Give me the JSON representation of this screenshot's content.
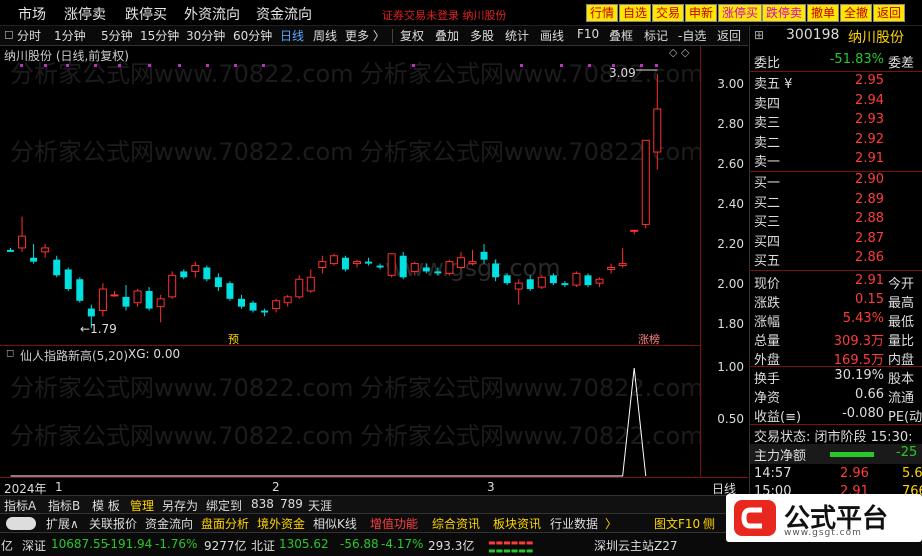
{
  "menu": {
    "items": [
      "市场",
      "涨停卖",
      "跌停买",
      "外资流向",
      "资金流向"
    ],
    "notice": "证券交易未登录 纳川股份",
    "buttons": [
      "行情",
      "自选",
      "交易",
      "申新",
      "涨停买",
      "跌停卖",
      "撤单",
      "全撤",
      "返回"
    ]
  },
  "period": {
    "items": [
      "分时",
      "1分钟",
      "5分钟",
      "15分钟",
      "30分钟",
      "60分钟",
      "日线",
      "周线",
      "更多 〉"
    ],
    "active": "日线",
    "tools": [
      "复权",
      "叠加",
      "多股",
      "统计",
      "画线",
      "F10",
      "叠框",
      "标记",
      "-自选",
      "返回"
    ]
  },
  "chart": {
    "title": "纳川股份 (日线,前复权)",
    "y_ticks": [
      "3.00",
      "2.80",
      "2.60",
      "2.40",
      "2.20",
      "2.00",
      "1.80"
    ],
    "high_label": "3.09",
    "low_label": "1.79",
    "marker_1": "预",
    "marker_2": "涨榜",
    "x_labels": [
      "2024年",
      "1",
      "2",
      "3"
    ],
    "axis_unit": "日线",
    "watermark_1": "分析家公式网www.70822.com",
    "watermark_2": "www.gsgt.com"
  },
  "chart_data": {
    "type": "candlestick",
    "title": "纳川股份 (日线,前复权)",
    "ylim": [
      1.75,
      3.15
    ],
    "candles": [
      {
        "o": 2.19,
        "h": 2.2,
        "l": 2.18,
        "c": 2.18
      },
      {
        "o": 2.2,
        "h": 2.36,
        "l": 2.18,
        "c": 2.26
      },
      {
        "o": 2.15,
        "h": 2.22,
        "l": 2.12,
        "c": 2.13
      },
      {
        "o": 2.18,
        "h": 2.22,
        "l": 2.15,
        "c": 2.2
      },
      {
        "o": 2.14,
        "h": 2.16,
        "l": 2.05,
        "c": 2.06
      },
      {
        "o": 2.09,
        "h": 2.1,
        "l": 1.98,
        "c": 1.99
      },
      {
        "o": 2.04,
        "h": 2.05,
        "l": 1.92,
        "c": 1.93
      },
      {
        "o": 1.89,
        "h": 1.91,
        "l": 1.79,
        "c": 1.85
      },
      {
        "o": 1.88,
        "h": 2.02,
        "l": 1.85,
        "c": 1.99
      },
      {
        "o": 1.96,
        "h": 1.98,
        "l": 1.95,
        "c": 1.96
      },
      {
        "o": 1.95,
        "h": 2.01,
        "l": 1.88,
        "c": 1.9
      },
      {
        "o": 1.92,
        "h": 1.99,
        "l": 1.9,
        "c": 1.98
      },
      {
        "o": 1.98,
        "h": 2.0,
        "l": 1.88,
        "c": 1.89
      },
      {
        "o": 1.9,
        "h": 1.96,
        "l": 1.82,
        "c": 1.94
      },
      {
        "o": 1.95,
        "h": 2.08,
        "l": 1.94,
        "c": 2.06
      },
      {
        "o": 2.08,
        "h": 2.09,
        "l": 2.04,
        "c": 2.05
      },
      {
        "o": 2.08,
        "h": 2.13,
        "l": 2.05,
        "c": 2.11
      },
      {
        "o": 2.1,
        "h": 2.11,
        "l": 2.03,
        "c": 2.04
      },
      {
        "o": 2.05,
        "h": 2.07,
        "l": 1.98,
        "c": 2.0
      },
      {
        "o": 2.02,
        "h": 2.03,
        "l": 1.93,
        "c": 1.94
      },
      {
        "o": 1.94,
        "h": 1.96,
        "l": 1.89,
        "c": 1.9
      },
      {
        "o": 1.92,
        "h": 1.93,
        "l": 1.87,
        "c": 1.88
      },
      {
        "o": 1.88,
        "h": 1.89,
        "l": 1.85,
        "c": 1.87
      },
      {
        "o": 1.89,
        "h": 1.94,
        "l": 1.87,
        "c": 1.93
      },
      {
        "o": 1.92,
        "h": 1.96,
        "l": 1.9,
        "c": 1.95
      },
      {
        "o": 1.95,
        "h": 2.06,
        "l": 1.94,
        "c": 2.04
      },
      {
        "o": 1.98,
        "h": 2.09,
        "l": 1.97,
        "c": 2.05
      },
      {
        "o": 2.1,
        "h": 2.16,
        "l": 2.07,
        "c": 2.13
      },
      {
        "o": 2.12,
        "h": 2.17,
        "l": 2.11,
        "c": 2.16
      },
      {
        "o": 2.15,
        "h": 2.16,
        "l": 2.08,
        "c": 2.09
      },
      {
        "o": 2.12,
        "h": 2.14,
        "l": 2.1,
        "c": 2.13
      },
      {
        "o": 2.13,
        "h": 2.15,
        "l": 2.11,
        "c": 2.12
      },
      {
        "o": 2.11,
        "h": 2.12,
        "l": 2.09,
        "c": 2.1
      },
      {
        "o": 2.06,
        "h": 2.17,
        "l": 2.05,
        "c": 2.17
      },
      {
        "o": 2.16,
        "h": 2.18,
        "l": 2.04,
        "c": 2.05
      },
      {
        "o": 2.08,
        "h": 2.13,
        "l": 2.06,
        "c": 2.12
      },
      {
        "o": 2.1,
        "h": 2.12,
        "l": 2.07,
        "c": 2.08
      },
      {
        "o": 2.08,
        "h": 2.1,
        "l": 2.06,
        "c": 2.07
      },
      {
        "o": 2.07,
        "h": 2.14,
        "l": 2.06,
        "c": 2.13
      },
      {
        "o": 2.1,
        "h": 2.18,
        "l": 2.09,
        "c": 2.15
      },
      {
        "o": 2.12,
        "h": 2.19,
        "l": 2.11,
        "c": 2.13
      },
      {
        "o": 2.18,
        "h": 2.22,
        "l": 2.12,
        "c": 2.14
      },
      {
        "o": 2.12,
        "h": 2.14,
        "l": 2.03,
        "c": 2.05
      },
      {
        "o": 2.06,
        "h": 2.07,
        "l": 2.01,
        "c": 2.02
      },
      {
        "o": 1.99,
        "h": 2.04,
        "l": 1.91,
        "c": 2.02
      },
      {
        "o": 2.04,
        "h": 2.06,
        "l": 1.98,
        "c": 1.99
      },
      {
        "o": 2.0,
        "h": 2.06,
        "l": 1.99,
        "c": 2.05
      },
      {
        "o": 2.06,
        "h": 2.07,
        "l": 2.01,
        "c": 2.02
      },
      {
        "o": 2.02,
        "h": 2.03,
        "l": 2.0,
        "c": 2.01
      },
      {
        "o": 2.01,
        "h": 2.08,
        "l": 2.0,
        "c": 2.07
      },
      {
        "o": 2.06,
        "h": 2.07,
        "l": 2.0,
        "c": 2.01
      },
      {
        "o": 2.02,
        "h": 2.05,
        "l": 2.0,
        "c": 2.04
      },
      {
        "o": 2.09,
        "h": 2.12,
        "l": 2.07,
        "c": 2.1
      },
      {
        "o": 2.11,
        "h": 2.2,
        "l": 2.1,
        "c": 2.12
      },
      {
        "o": 2.29,
        "h": 2.29,
        "l": 2.27,
        "c": 2.29
      },
      {
        "o": 2.32,
        "h": 2.75,
        "l": 2.3,
        "c": 2.75
      },
      {
        "o": 2.69,
        "h": 3.09,
        "l": 2.6,
        "c": 2.91
      }
    ],
    "indicator": {
      "name": "仙人指路新高(5,20)",
      "value_label": "XG: 0.00",
      "ylim": [
        0,
        1
      ],
      "ticks": [
        "1.00",
        "0.50"
      ],
      "series": [
        0,
        0,
        0,
        0,
        0,
        0,
        0,
        0,
        0,
        0,
        0,
        0,
        0,
        0,
        0,
        0,
        0,
        0,
        0,
        0,
        0,
        0,
        0,
        0,
        0,
        0,
        0,
        0,
        0,
        0,
        0,
        0,
        0,
        0,
        0,
        0,
        0,
        0,
        0,
        0,
        0,
        0,
        0,
        0,
        0,
        0,
        0,
        0,
        0,
        0,
        0,
        0,
        0,
        0,
        1,
        0
      ]
    }
  },
  "quote": {
    "code": "300198",
    "name": "纳川股份",
    "weibi_label": "委比",
    "weibi": "-51.83%",
    "weicha_label": "委差",
    "asks": [
      {
        "label": "卖五 ¥",
        "price": "2.95"
      },
      {
        "label": "卖四",
        "price": "2.94"
      },
      {
        "label": "卖三",
        "price": "2.93"
      },
      {
        "label": "卖二",
        "price": "2.92"
      },
      {
        "label": "卖一",
        "price": "2.91"
      }
    ],
    "bids": [
      {
        "label": "买一",
        "price": "2.90"
      },
      {
        "label": "买二",
        "price": "2.89"
      },
      {
        "label": "买三",
        "price": "2.88"
      },
      {
        "label": "买四",
        "price": "2.87"
      },
      {
        "label": "买五",
        "price": "2.86"
      }
    ],
    "stats": [
      {
        "l": "现价",
        "v": "2.91",
        "r": "今开"
      },
      {
        "l": "涨跌",
        "v": "0.15",
        "r": "最高"
      },
      {
        "l": "涨幅",
        "v": "5.43%",
        "r": "最低"
      },
      {
        "l": "总量",
        "v": "309.3万",
        "r": "量比"
      },
      {
        "l": "外盘",
        "v": "169.5万",
        "r": "内盘"
      }
    ],
    "stats2": [
      {
        "l": "换手",
        "v": "30.19%",
        "r": "股本"
      },
      {
        "l": "净资",
        "v": "0.66",
        "r": "流通"
      },
      {
        "l": "收益(≡)",
        "v": "-0.080",
        "r": "PE(动"
      }
    ],
    "trade_state": "交易状态: 闭市阶段 15:30:",
    "main_flow_label": "主力净额",
    "main_flow": "-25",
    "ticks": [
      {
        "t": "14:57",
        "p": "2.96",
        "v": "5.6"
      },
      {
        "t": "15:00",
        "p": "2.91",
        "v": "766"
      }
    ]
  },
  "tabs1": [
    "指标A",
    "指标B",
    "模 板",
    "管理",
    "另存为",
    "绑定到",
    "838",
    "789",
    "天涯"
  ],
  "tabs2": [
    "扩展∧",
    "关联报价",
    "资金流向",
    "盘面分析",
    "境外资金",
    "相似K线",
    "增值功能",
    "综合资讯",
    "板块资讯",
    "行业数据",
    "〉",
    "图文F10",
    "侧"
  ],
  "status": {
    "prefix": "亿",
    "idx1_name": "深证",
    "idx1_val": "10687.55",
    "idx1_chg": "-191.94",
    "idx1_pct": "-1.76%",
    "idx1_amt": "9277亿",
    "idx2_name": "北证",
    "idx2_val": "1305.62",
    "idx2_chg": "-56.88",
    "idx2_pct": "-4.17%",
    "idx2_amt": "293.3亿",
    "site": "深圳云主站Z27"
  },
  "logo": {
    "text": "公式平台",
    "url": "www.gsgt.com"
  }
}
